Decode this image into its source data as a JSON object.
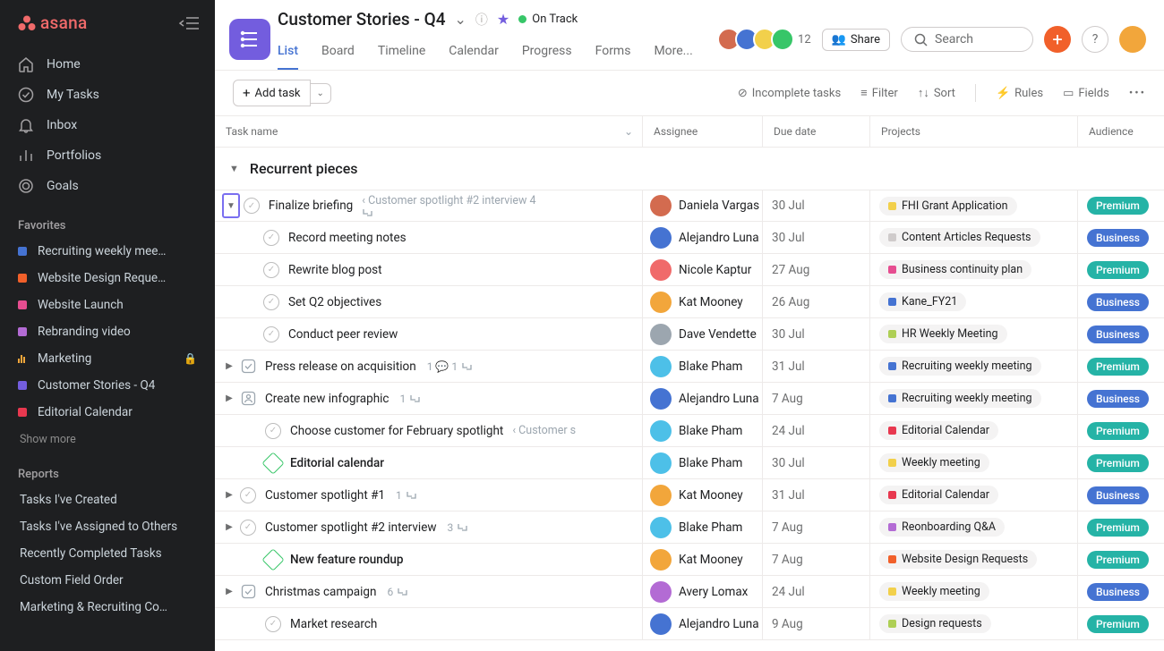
{
  "app": {
    "name": "asana",
    "search_placeholder": "Search",
    "count": "12",
    "share": "Share"
  },
  "nav": [
    {
      "label": "Home",
      "icon": "home"
    },
    {
      "label": "My Tasks",
      "icon": "check"
    },
    {
      "label": "Inbox",
      "icon": "bell"
    },
    {
      "label": "Portfolios",
      "icon": "bars"
    },
    {
      "label": "Goals",
      "icon": "target"
    }
  ],
  "favorites_label": "Favorites",
  "favorites": [
    {
      "label": "Recruiting weekly mee…",
      "color": "#4573d2"
    },
    {
      "label": "Website Design Reque…",
      "color": "#f1602a"
    },
    {
      "label": "Website Launch",
      "color": "#e64d90"
    },
    {
      "label": "Rebranding video",
      "color": "#b36bd4"
    },
    {
      "label": "Marketing",
      "type": "bars",
      "lock": true
    },
    {
      "label": "Customer Stories - Q4",
      "color": "#735dde"
    },
    {
      "label": "Editorial Calendar",
      "color": "#e8384f"
    }
  ],
  "show_more": "Show more",
  "reports_label": "Reports",
  "reports": [
    "Tasks I've Created",
    "Tasks I've Assigned to Others",
    "Recently Completed Tasks",
    "Custom Field Order",
    "Marketing & Recruiting Co…"
  ],
  "project": {
    "title": "Customer Stories - Q4",
    "status": "On Track",
    "tabs": [
      "List",
      "Board",
      "Timeline",
      "Calendar",
      "Progress",
      "Forms",
      "More..."
    ],
    "active_tab": 0
  },
  "toolbar": {
    "add": "Add task",
    "incomplete": "Incomplete tasks",
    "filter": "Filter",
    "sort": "Sort",
    "rules": "Rules",
    "fields": "Fields"
  },
  "columns": {
    "task": "Task name",
    "assignee": "Assignee",
    "due": "Due date",
    "projects": "Projects",
    "audience": "Audience"
  },
  "section": "Recurrent pieces",
  "audience_labels": {
    "premium": "Premium",
    "business": "Business"
  },
  "assignee_colors": {
    "Daniela Vargas": "#d36b4f",
    "Alejandro Luna": "#4573d2",
    "Nicole Kaptur": "#f06a6a",
    "Kat Mooney": "#f2a63b",
    "Dave Vendette": "#9ca6af",
    "Blake Pham": "#4dc0e8",
    "Avery Lomax": "#b36bd4"
  },
  "tasks": [
    {
      "exp": "down",
      "boxed": true,
      "check": "circle",
      "name": "Finalize briefing",
      "parent": "‹ Customer spotlight #2 interview 4 ⇆",
      "assignee": "Daniela Vargas",
      "due": "30 Jul",
      "project": {
        "name": "FHI Grant Application",
        "color": "#f2d04b"
      },
      "audience": "premium",
      "indent": 0
    },
    {
      "check": "circle",
      "name": "Record meeting notes",
      "assignee": "Alejandro Luna",
      "due": "30 Jul",
      "project": {
        "name": "Content Articles Requests",
        "color": "#cfcbcb"
      },
      "audience": "business",
      "indent": 1
    },
    {
      "check": "circle",
      "name": "Rewrite blog post",
      "assignee": "Nicole Kaptur",
      "due": "27 Aug",
      "project": {
        "name": "Business continuity plan",
        "color": "#e64d90"
      },
      "audience": "premium",
      "indent": 1
    },
    {
      "check": "circle",
      "name": "Set Q2 objectives",
      "assignee": "Kat Mooney",
      "due": "26 Aug",
      "project": {
        "name": "Kane_FY21",
        "color": "#4573d2"
      },
      "audience": "business",
      "indent": 1
    },
    {
      "check": "circle",
      "name": "Conduct peer review",
      "assignee": "Dave Vendette",
      "due": "30 Jul",
      "project": {
        "name": "HR Weekly Meeting",
        "color": "#aecf55"
      },
      "audience": "business",
      "indent": 1
    },
    {
      "exp": "right",
      "icon": "approval",
      "name": "Press release on acquisition",
      "meta": "1 💬  1 ⇆",
      "assignee": "Blake Pham",
      "due": "31 Jul",
      "project": {
        "name": "Recruiting weekly meeting",
        "color": "#4573d2"
      },
      "audience": "premium",
      "indent": 0
    },
    {
      "exp": "right",
      "icon": "person",
      "name": "Create new infographic",
      "meta": "1 ⇆",
      "assignee": "Alejandro Luna",
      "due": "7 Aug",
      "project": {
        "name": "Recruiting weekly meeting",
        "color": "#4573d2"
      },
      "audience": "business",
      "indent": 0
    },
    {
      "check": "circle",
      "name": "Choose customer for February spotlight",
      "parent": "‹ Customer s",
      "assignee": "Blake Pham",
      "due": "24 Jul",
      "project": {
        "name": "Editorial Calendar",
        "color": "#e8384f"
      },
      "audience": "premium",
      "indent": 0,
      "extra_pad": true
    },
    {
      "check": "diamond",
      "name": "Editorial calendar",
      "bold": true,
      "assignee": "Blake Pham",
      "due": "30 Jul",
      "project": {
        "name": "Weekly meeting",
        "color": "#f2d04b"
      },
      "audience": "premium",
      "indent": 0,
      "extra_pad": true
    },
    {
      "exp": "right",
      "check": "circle",
      "name": "Customer spotlight #1",
      "meta": "1 ⇆",
      "assignee": "Kat Mooney",
      "due": "31 Jul",
      "project": {
        "name": "Editorial Calendar",
        "color": "#e8384f"
      },
      "audience": "business",
      "indent": 0
    },
    {
      "exp": "right",
      "check": "circle",
      "name": "Customer spotlight #2 interview",
      "meta": "3 ⇆",
      "assignee": "Blake Pham",
      "due": "7 Aug",
      "project": {
        "name": "Reonboarding Q&A",
        "color": "#b36bd4"
      },
      "audience": "premium",
      "indent": 0
    },
    {
      "check": "diamond",
      "name": "New feature roundup",
      "bold": true,
      "assignee": "Kat Mooney",
      "due": "7 Aug",
      "project": {
        "name": "Website Design Requests",
        "color": "#f1602a"
      },
      "audience": "premium",
      "indent": 0,
      "extra_pad": true
    },
    {
      "exp": "right",
      "icon": "approval",
      "name": "Christmas campaign",
      "meta": "6 ⇆",
      "assignee": "Avery Lomax",
      "due": "24 Jul",
      "project": {
        "name": "Weekly meeting",
        "color": "#f2d04b"
      },
      "audience": "business",
      "indent": 0
    },
    {
      "check": "circle",
      "name": "Market research",
      "assignee": "Alejandro Luna",
      "due": "9 Aug",
      "project": {
        "name": "Design requests",
        "color": "#aecf55"
      },
      "audience": "premium",
      "indent": 0,
      "extra_pad": true
    }
  ]
}
